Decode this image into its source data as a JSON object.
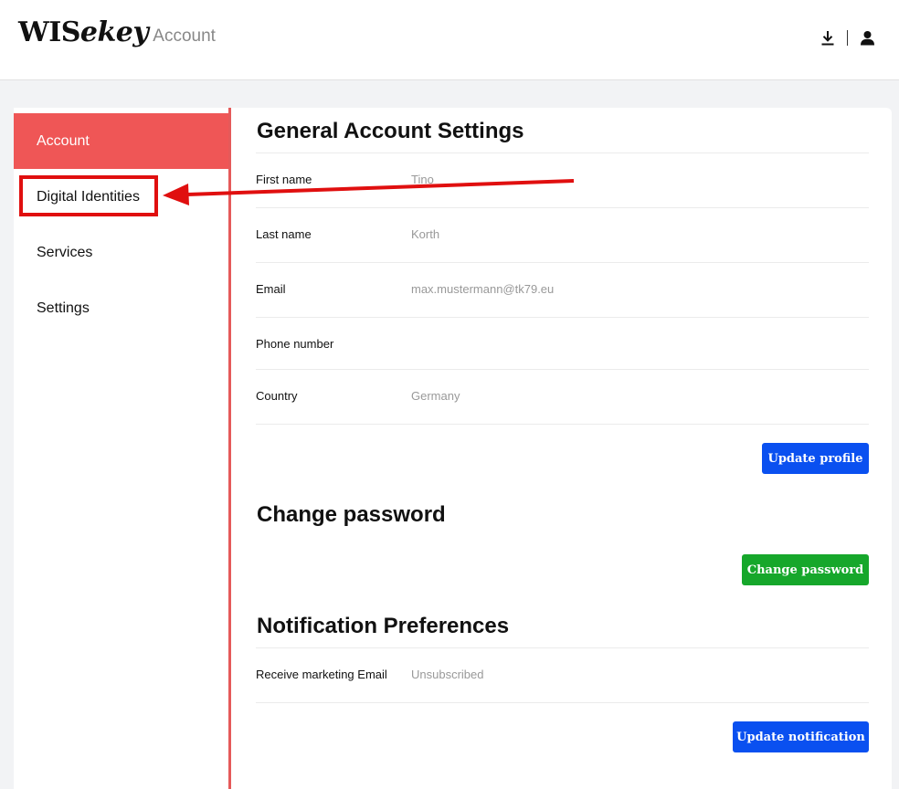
{
  "header": {
    "logo_part1": "WIS",
    "logo_part2": "e",
    "logo_part3": "key",
    "logo_sub": "Account",
    "icons": [
      "download-icon",
      "user-icon"
    ]
  },
  "sidebar": {
    "items": [
      {
        "label": "Account",
        "active": true
      },
      {
        "label": "Digital Identities",
        "active": false
      },
      {
        "label": "Services",
        "active": false
      },
      {
        "label": "Settings",
        "active": false
      }
    ]
  },
  "general": {
    "title": "General Account Settings",
    "rows": [
      {
        "label": "First name",
        "value": "Tino"
      },
      {
        "label": "Last name",
        "value": "Korth"
      },
      {
        "label": "Email",
        "value": "max.mustermann@tk79.eu"
      },
      {
        "label": "Phone number",
        "value": ""
      },
      {
        "label": "Country",
        "value": "Germany"
      }
    ],
    "update_button": "Update profile"
  },
  "password": {
    "title": "Change password",
    "button": "Change password"
  },
  "notifications": {
    "title": "Notification Preferences",
    "rows": [
      {
        "label": "Receive marketing Email",
        "value": "Unsubscribed"
      }
    ],
    "button": "Update notification"
  },
  "colors": {
    "accent": "#ef5656",
    "primary_button": "#0a50f0",
    "success_button": "#16a72b",
    "annotation": "#e00f0f"
  }
}
